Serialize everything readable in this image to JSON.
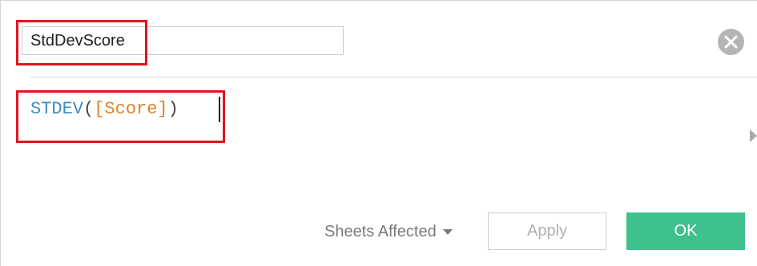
{
  "calc": {
    "name_value": "StdDevScore",
    "formula": {
      "function": "STDEV",
      "open": "(",
      "field": "[Score]",
      "close": ")"
    }
  },
  "footer": {
    "sheets_affected_label": "Sheets Affected",
    "apply_label": "Apply",
    "ok_label": "OK"
  },
  "icons": {
    "close": "close-icon",
    "expand": "chevron-right-icon",
    "dropdown": "caret-down-icon"
  },
  "colors": {
    "ok_button": "#3ec18d",
    "highlight": "#e0161e",
    "function_token": "#3a8fc4",
    "field_token": "#e0822a"
  }
}
